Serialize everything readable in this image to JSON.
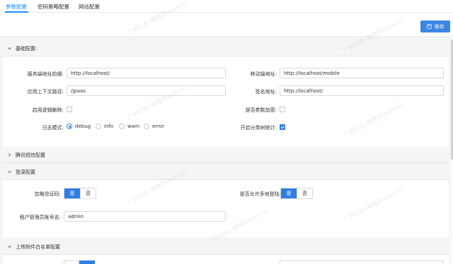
{
  "tabs": [
    {
      "label": "参数配置",
      "active": true
    },
    {
      "label": "密码策略配置",
      "active": false
    },
    {
      "label": "网站配置",
      "active": false
    }
  ],
  "toolbar": {
    "save_label": "保存"
  },
  "accent_color": "#2f7ee6",
  "watermark": "广州红迅--管理员(admin)",
  "sections": {
    "basic": {
      "title": "基础配置:",
      "expanded": true,
      "fields": {
        "server_prefix": {
          "label": "服务端地址前缀:",
          "value": "http://localhost/"
        },
        "mobile_url": {
          "label": "移动端地址:",
          "value": "http://localhost/mobile"
        },
        "context_path": {
          "label": "应用上下文路径:",
          "value": "/jpaas"
        },
        "sign_url": {
          "label": "签名地址:",
          "value": "http://localhost/"
        },
        "logical_delete": {
          "label": "启用逻辑删除:",
          "checked": false
        },
        "param_encrypt": {
          "label": "是否参数加密:",
          "checked": false
        },
        "log_mode": {
          "label": "日志模式:",
          "options": [
            "debug",
            "info",
            "warn",
            "error"
          ],
          "selected": "debug"
        },
        "category_tree_stats": {
          "label": "开启分类树统计:",
          "checked": true
        }
      }
    },
    "sms": {
      "title": "腾讯短信配置",
      "expanded": false
    },
    "login": {
      "title": "登录配置",
      "expanded": true,
      "fields": {
        "ignore_captcha": {
          "label": "忽略验证码:",
          "yes": "是",
          "no": "否",
          "selected": "是"
        },
        "multi_login": {
          "label": "是否允许多地登陆:",
          "yes": "是",
          "no": "否",
          "selected": "是"
        },
        "tenant_admin": {
          "label": "租户管理员账号名:",
          "value": "admin"
        }
      }
    },
    "upload": {
      "title": "上传附件白名单配置",
      "expanded": true
    }
  }
}
